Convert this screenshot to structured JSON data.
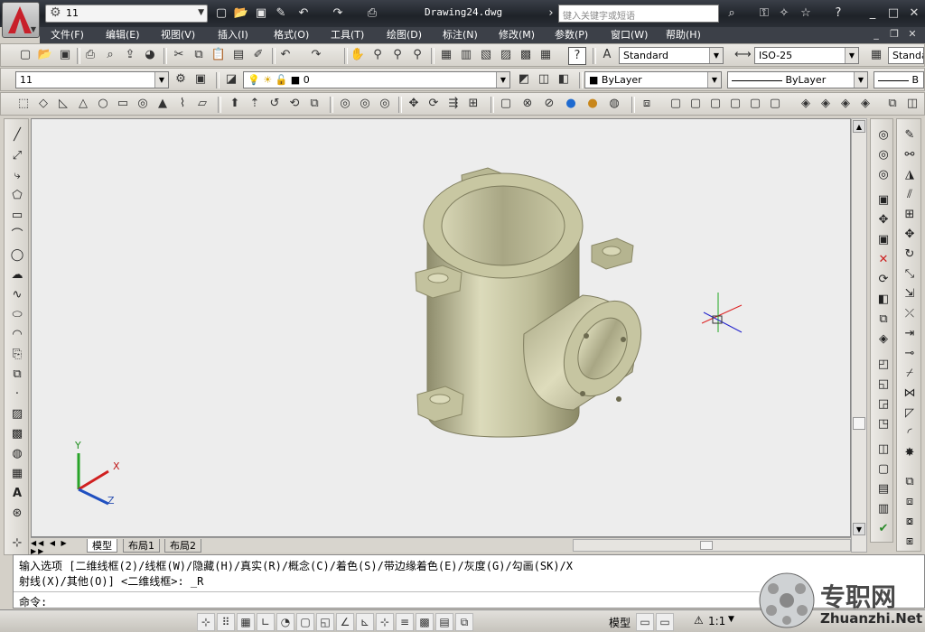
{
  "title_bar": {
    "workspace": "11",
    "document_title": "Drawing24.dwg",
    "search_placeholder": "键入关键字或短语"
  },
  "menu": {
    "items": [
      "文件(F)",
      "编辑(E)",
      "视图(V)",
      "插入(I)",
      "格式(O)",
      "工具(T)",
      "绘图(D)",
      "标注(N)",
      "修改(M)",
      "参数(P)",
      "窗口(W)",
      "帮助(H)"
    ]
  },
  "styles_toolbar": {
    "text_style": "Standard",
    "dim_style": "ISO-25",
    "table_style": "Standa"
  },
  "layers_toolbar": {
    "workspace_combo": "11",
    "layer_combo": "0",
    "color_combo": "ByLayer",
    "linetype_combo": "ByLayer",
    "lineweight_combo": "B"
  },
  "layout_tabs": [
    "模型",
    "布局1",
    "布局2"
  ],
  "ucs": {
    "x": "X",
    "y": "Y",
    "z": "Z"
  },
  "command": {
    "history_line1": "输入选项 [二维线框(2)/线框(W)/隐藏(H)/真实(R)/概念(C)/着色(S)/带边缘着色(E)/灰度(G)/勾画(SK)/X",
    "history_line2": "射线(X)/其他(O)] <二维线框>: _R",
    "prompt": "命令:"
  },
  "status_bar": {
    "model_label": "模型",
    "annotation_scale": "1:1"
  },
  "watermark": {
    "text": "专职网",
    "url_text": "Zhuanzhi.Net"
  },
  "colors": {
    "title_bg": "#22262c",
    "menu_bg": "#3c4048",
    "viewport_bg": "#ededed",
    "model_body": "#c9c8a4",
    "model_shadow": "#8e8c6c"
  }
}
